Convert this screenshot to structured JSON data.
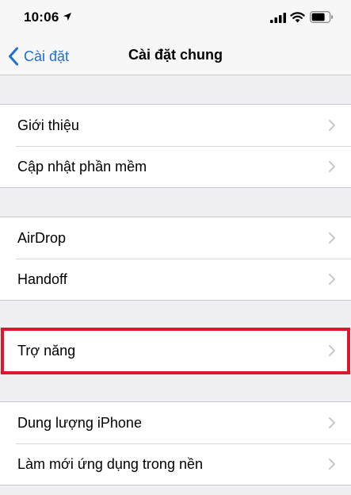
{
  "status_bar": {
    "time": "10:06",
    "location_icon": "location-arrow-icon",
    "signal_icon": "cellular-signal-icon",
    "wifi_icon": "wifi-icon",
    "battery_icon": "battery-icon"
  },
  "nav": {
    "back_label": "Cài đặt",
    "back_icon": "chevron-left-icon",
    "title": "Cài đặt chung"
  },
  "groups": [
    {
      "items": [
        {
          "label": "Giới thiệu"
        },
        {
          "label": "Cập nhật phần mềm"
        }
      ]
    },
    {
      "items": [
        {
          "label": "AirDrop"
        },
        {
          "label": "Handoff"
        }
      ]
    },
    {
      "items": [
        {
          "label": "Trợ năng",
          "highlighted": true
        }
      ]
    },
    {
      "items": [
        {
          "label": "Dung lượng iPhone"
        },
        {
          "label": "Làm mới ứng dụng trong nền"
        }
      ]
    }
  ],
  "colors": {
    "accent": "#1f6fd6",
    "background": "#efeff4",
    "highlight": "#e0172a",
    "chevron": "#c7c7cc"
  }
}
